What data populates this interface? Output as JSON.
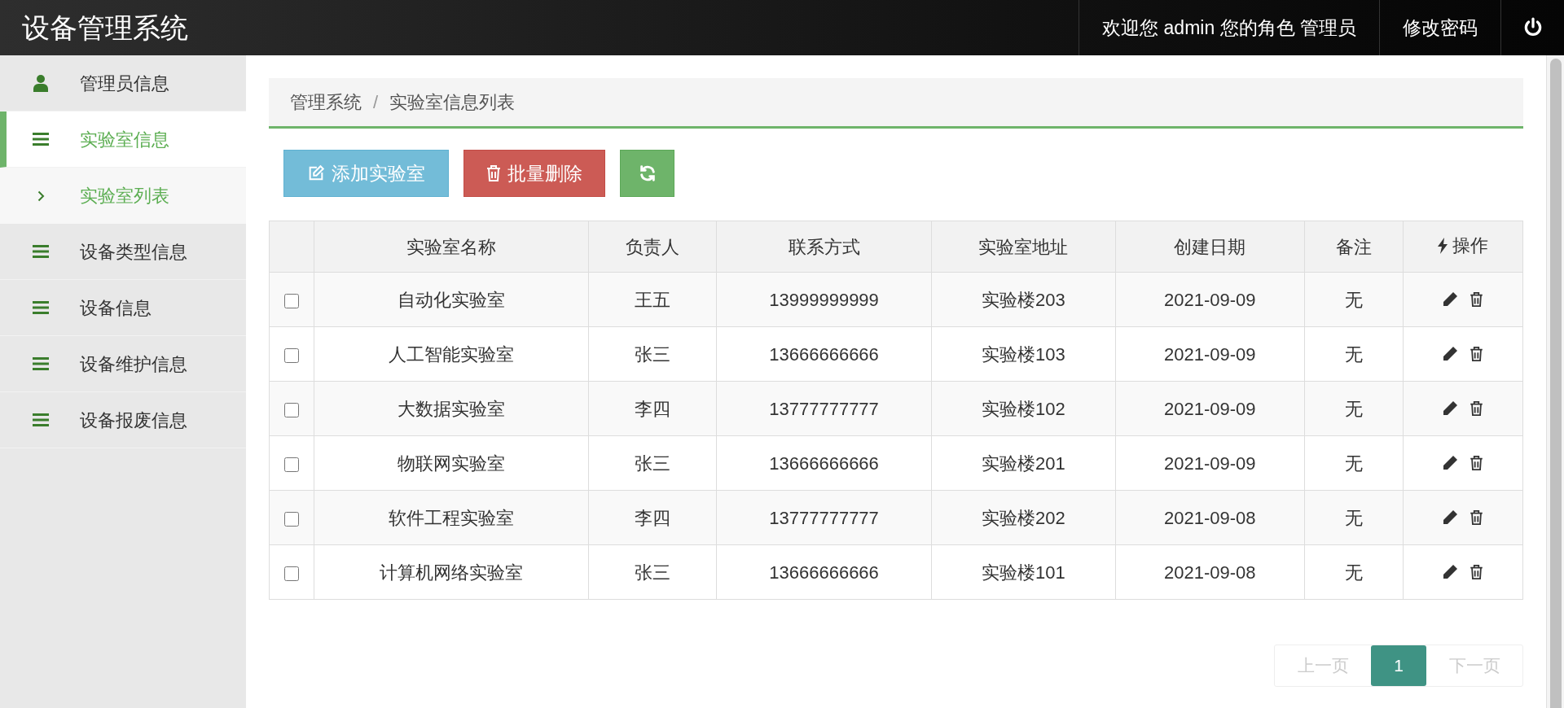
{
  "header": {
    "title": "设备管理系统",
    "welcome": "欢迎您 admin 您的角色 管理员",
    "change_password": "修改密码"
  },
  "sidebar": {
    "items": [
      {
        "label": "管理员信息",
        "kind": "user",
        "selected": false
      },
      {
        "label": "实验室信息",
        "kind": "menu",
        "selected": true,
        "children": [
          {
            "label": "实验室列表",
            "selected": true
          }
        ]
      },
      {
        "label": "设备类型信息",
        "kind": "menu",
        "selected": false
      },
      {
        "label": "设备信息",
        "kind": "menu",
        "selected": false
      },
      {
        "label": "设备维护信息",
        "kind": "menu",
        "selected": false
      },
      {
        "label": "设备报废信息",
        "kind": "menu",
        "selected": false
      }
    ]
  },
  "breadcrumb": {
    "items": [
      "管理系统",
      "实验室信息列表"
    ],
    "separator": "/"
  },
  "toolbar": [
    {
      "kind": "add",
      "label": "添加实验室"
    },
    {
      "kind": "delete",
      "label": "批量删除"
    },
    {
      "kind": "refresh"
    }
  ],
  "table": {
    "columns": [
      "实验室名称",
      "负责人",
      "联系方式",
      "实验室地址",
      "创建日期",
      "备注",
      "操作"
    ],
    "rows": [
      {
        "checked": false,
        "cells": [
          "自动化实验室",
          "王五",
          "13999999999",
          "实验楼203",
          "2021-09-09",
          "无"
        ]
      },
      {
        "checked": false,
        "cells": [
          "人工智能实验室",
          "张三",
          "13666666666",
          "实验楼103",
          "2021-09-09",
          "无"
        ]
      },
      {
        "checked": false,
        "cells": [
          "大数据实验室",
          "李四",
          "13777777777",
          "实验楼102",
          "2021-09-09",
          "无"
        ]
      },
      {
        "checked": false,
        "cells": [
          "物联网实验室",
          "张三",
          "13666666666",
          "实验楼201",
          "2021-09-09",
          "无"
        ]
      },
      {
        "checked": false,
        "cells": [
          "软件工程实验室",
          "李四",
          "13777777777",
          "实验楼202",
          "2021-09-08",
          "无"
        ]
      },
      {
        "checked": false,
        "cells": [
          "计算机网络实验室",
          "张三",
          "13666666666",
          "实验楼101",
          "2021-09-08",
          "无"
        ]
      }
    ]
  },
  "pagination": {
    "prev": {
      "label": "上一页",
      "disabled": true
    },
    "pages": [
      {
        "label": "1",
        "selected": true
      }
    ],
    "next": {
      "label": "下一页",
      "disabled": true
    }
  }
}
